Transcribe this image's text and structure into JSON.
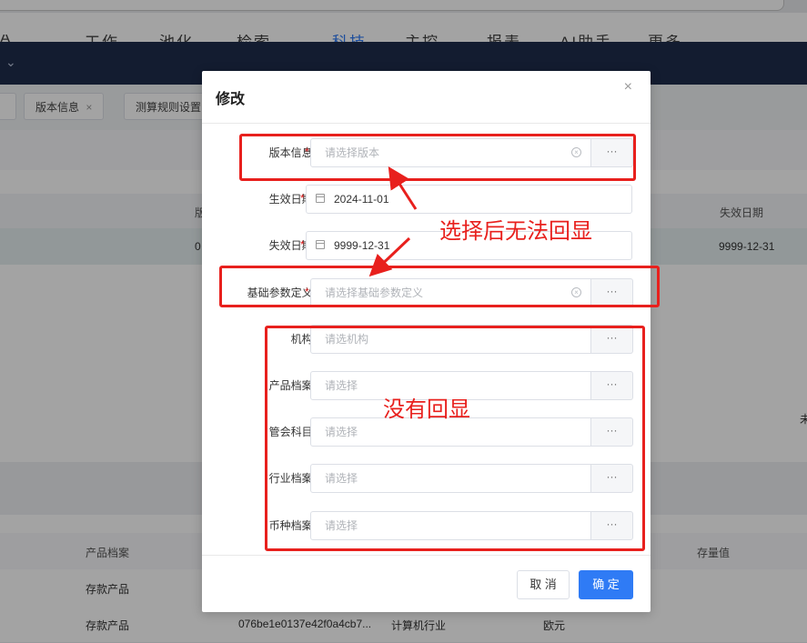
{
  "background": {
    "topnav": [
      {
        "label": "A",
        "active": false
      },
      {
        "label": "工作",
        "active": false
      },
      {
        "label": "池化",
        "active": false
      },
      {
        "label": "检索",
        "active": false
      },
      {
        "label": "科技",
        "active": true
      },
      {
        "label": "主控",
        "active": false
      },
      {
        "label": "报表",
        "active": false
      },
      {
        "label": "AI助手",
        "active": false
      },
      {
        "label": "更多",
        "active": false
      }
    ],
    "tabs": [
      {
        "label": "版本信息",
        "close": "×"
      },
      {
        "label": "测算规则设置"
      }
    ],
    "grid1": {
      "header_partial": "版",
      "col_expire": "失效日期",
      "row_partial": "0",
      "row_expire": "9999-12-31",
      "edge_char": "未"
    },
    "grid2": {
      "col_product": "产品档案",
      "col_stock": "存量值",
      "rows": [
        {
          "product": "存款产品",
          "id": "",
          "industry": "",
          "currency": ""
        },
        {
          "product": "存款产品",
          "id": "076be1e0137e42f0a4cb7...",
          "industry": "计算机行业",
          "currency": "欧元"
        }
      ]
    }
  },
  "dialog": {
    "title": "修改",
    "close_icon": "×",
    "fields": [
      {
        "label": "版本信息:",
        "required": true,
        "placeholder": "请选择版本",
        "value": "",
        "clearable": true,
        "has_more": true,
        "type": "select"
      },
      {
        "label": "生效日期:",
        "required": true,
        "placeholder": "",
        "value": "2024-11-01",
        "type": "date"
      },
      {
        "label": "失效日期:",
        "required": true,
        "placeholder": "",
        "value": "9999-12-31",
        "type": "date"
      },
      {
        "label": "基础参数定义:",
        "required": true,
        "placeholder": "请选择基础参数定义",
        "value": "",
        "clearable": true,
        "has_more": true,
        "type": "select"
      },
      {
        "label": "机构:",
        "required": false,
        "placeholder": "请选机构",
        "value": "",
        "has_more": true,
        "type": "select"
      },
      {
        "label": "产品档案:",
        "required": false,
        "placeholder": "请选择",
        "value": "",
        "has_more": true,
        "type": "select"
      },
      {
        "label": "管会科目:",
        "required": false,
        "placeholder": "请选择",
        "value": "",
        "has_more": true,
        "type": "select"
      },
      {
        "label": "行业档案:",
        "required": false,
        "placeholder": "请选择",
        "value": "",
        "has_more": true,
        "type": "select"
      },
      {
        "label": "币种档案:",
        "required": false,
        "placeholder": "请选择",
        "value": "",
        "has_more": true,
        "type": "select"
      }
    ],
    "more_label": "···",
    "cancel_label": "取 消",
    "confirm_label": "确 定"
  },
  "annotations": {
    "text1": "选择后无法回显",
    "text2": "没有回显",
    "color": "#e8201d"
  },
  "colors": {
    "navbar": "#1f2d4c",
    "primary": "#2f7bf5",
    "required": "#e02020"
  }
}
